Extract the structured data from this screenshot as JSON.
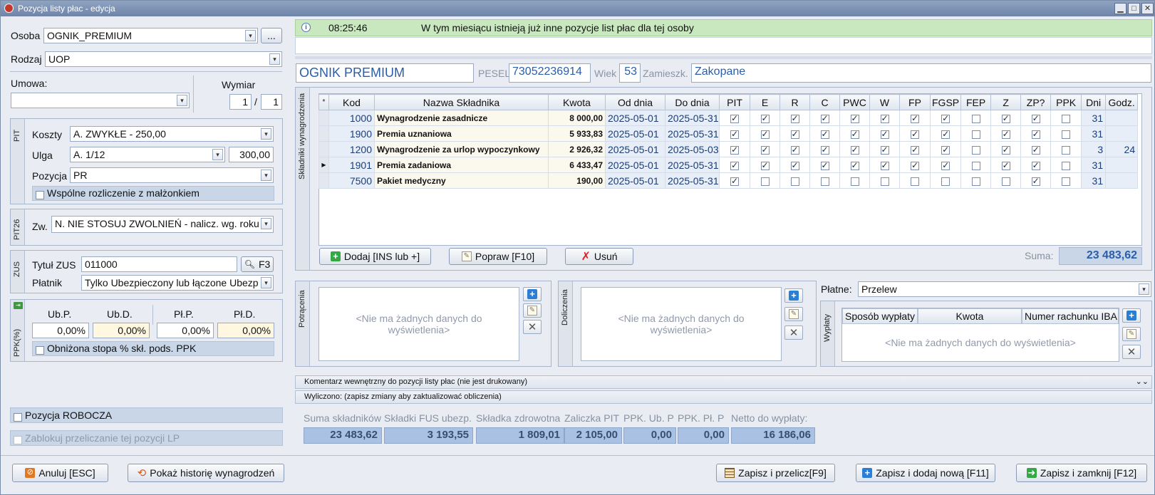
{
  "window": {
    "title": "Pozycja listy płac - edycja"
  },
  "left": {
    "osoba_label": "Osoba",
    "osoba_value": "OGNIK_PREMIUM",
    "osoba_btn": "...",
    "rodzaj_label": "Rodzaj",
    "rodzaj_value": "UOP",
    "umowa_label": "Umowa:",
    "umowa_value": "",
    "wymiar_label": "Wymiar",
    "wymiar_num": "1",
    "wymiar_sep": "/",
    "wymiar_den": "1",
    "pit": {
      "section_label": "PIT",
      "koszty_label": "Koszty",
      "koszty_value": "A. ZWYKŁE - 250,00",
      "ulga_label": "Ulga",
      "ulga_value": "A. 1/12",
      "ulga_amount": "300,00",
      "pozycja_label": "Pozycja",
      "pozycja_value": "PR",
      "wspolne_label": "Wspólne rozliczenie z małżonkiem",
      "wspolne_checked": false
    },
    "pit26": {
      "section_label": "PIT26",
      "zw_label": "Zw.",
      "zw_value": "N. NIE STOSUJ ZWOLNIEŃ - nalicz. wg. roku"
    },
    "zus": {
      "section_label": "ZUS",
      "tytul_label": "Tytuł ZUS",
      "tytul_value": "011000",
      "f3_label": "F3",
      "platnik_label": "Płatnik",
      "platnik_value": "Tylko Ubezpieczony lub łączone Ubezp"
    },
    "ppk": {
      "section_label": "PPK(%)",
      "headers": [
        "Ub.P.",
        "Ub.D.",
        "Pł.P.",
        "Pł.D."
      ],
      "values": [
        "0,00%",
        "0,00%",
        "0,00%",
        "0,00%"
      ],
      "obnizona_label": "Obniżona stopa % skł. pods. PPK",
      "obnizona_checked": false
    },
    "robocza_label": "Pozycja ROBOCZA",
    "zablokuj_label": "Zablokuj przeliczanie tej pozycji LP"
  },
  "info": {
    "time": "08:25:46",
    "message": "W tym miesiącu istnieją już inne pozycje list płac dla tej osoby"
  },
  "person": {
    "name": "OGNIK PREMIUM",
    "pesel_label": "PESEL",
    "pesel": "73052236914",
    "wiek_label": "Wiek",
    "wiek": "53",
    "zamieszk_label": "Zamieszk.",
    "zamieszk": "Zakopane"
  },
  "components": {
    "section_label": "Składniki wynagrodzenia",
    "columns": [
      "*",
      "Kod",
      "Nazwa Składnika",
      "Kwota",
      "Od dnia",
      "Do dnia",
      "PIT",
      "E",
      "R",
      "C",
      "PWC",
      "W",
      "FP",
      "FGSP",
      "FEP",
      "Z",
      "ZP?",
      "PPK",
      "Dni",
      "Godz."
    ],
    "rows": [
      {
        "kod": "1000",
        "nazwa": "Wynagrodzenie zasadnicze",
        "kwota": "8 000,00",
        "od": "2025-05-01",
        "do": "2025-05-31",
        "flags": [
          true,
          true,
          true,
          true,
          true,
          true,
          true,
          true,
          false,
          true,
          true,
          false
        ],
        "dni": "31",
        "godz": ""
      },
      {
        "kod": "1900",
        "nazwa": "Premia uznaniowa",
        "kwota": "5 933,83",
        "od": "2025-05-01",
        "do": "2025-05-31",
        "flags": [
          true,
          true,
          true,
          true,
          true,
          true,
          true,
          true,
          false,
          true,
          true,
          false
        ],
        "dni": "31",
        "godz": ""
      },
      {
        "kod": "1200",
        "nazwa": "Wynagrodzenie za urlop wypoczynkowy",
        "kwota": "2 926,32",
        "od": "2025-05-01",
        "do": "2025-05-03",
        "flags": [
          true,
          true,
          true,
          true,
          true,
          true,
          true,
          true,
          false,
          true,
          true,
          false
        ],
        "dni": "3",
        "godz": "24"
      },
      {
        "kod": "1901",
        "nazwa": "Premia zadaniowa",
        "kwota": "6 433,47",
        "od": "2025-05-01",
        "do": "2025-05-31",
        "flags": [
          true,
          true,
          true,
          true,
          true,
          true,
          true,
          true,
          false,
          true,
          true,
          false
        ],
        "dni": "31",
        "godz": "",
        "current": true
      },
      {
        "kod": "7500",
        "nazwa": "Pakiet medyczny",
        "kwota": "190,00",
        "od": "2025-05-01",
        "do": "2025-05-31",
        "flags": [
          true,
          false,
          false,
          false,
          false,
          false,
          false,
          false,
          false,
          false,
          true,
          false
        ],
        "dni": "31",
        "godz": ""
      }
    ],
    "add_btn": "Dodaj [INS lub +]",
    "edit_btn": "Popraw [F10]",
    "delete_btn": "Usuń",
    "suma_label": "Suma:",
    "suma_value": "23 483,62"
  },
  "potracenia": {
    "section_label": "Potrącenia",
    "empty": "<Nie ma żadnych danych do wyświetlenia>"
  },
  "doliczenia": {
    "section_label": "Doliczenia",
    "empty": "<Nie ma żadnych danych do wyświetlenia>"
  },
  "wyplaty": {
    "section_label": "Wypłaty",
    "platne_label": "Płatne:",
    "platne_value": "Przelew",
    "columns": [
      "Sposób wypłaty",
      "Kwota",
      "Numer rachunku IBAN"
    ],
    "empty": "<Nie ma żadnych danych do wyświetlenia>"
  },
  "komentarz": {
    "label": "Komentarz wewnętrzny do pozycji listy płac (nie jest drukowany)"
  },
  "wyliczono": {
    "label": "Wyliczono: (zapisz zmiany aby zaktualizować obliczenia)",
    "items": [
      {
        "label": "Suma składników",
        "value": "23 483,62"
      },
      {
        "label": "Składki FUS ubezp.",
        "value": "3 193,55"
      },
      {
        "label": "Składka zdrowotna",
        "value": "1 809,01"
      },
      {
        "label": "Zaliczka PIT",
        "value": "2 105,00"
      },
      {
        "label": "PPK. Ub. P",
        "value": "0,00"
      },
      {
        "label": "PPK. Pł. P",
        "value": "0,00"
      },
      {
        "label": "Netto do wypłaty:",
        "value": "16 186,06"
      }
    ]
  },
  "footer": {
    "anuluj": "Anuluj [ESC]",
    "historia": "Pokaż historię wynagrodzeń",
    "zapisz_przelicz": "Zapisz i przelicz[F9]",
    "zapisz_dodaj": "Zapisz i dodaj nową [F11]",
    "zapisz_zamknij": "Zapisz i zamknij [F12]"
  }
}
